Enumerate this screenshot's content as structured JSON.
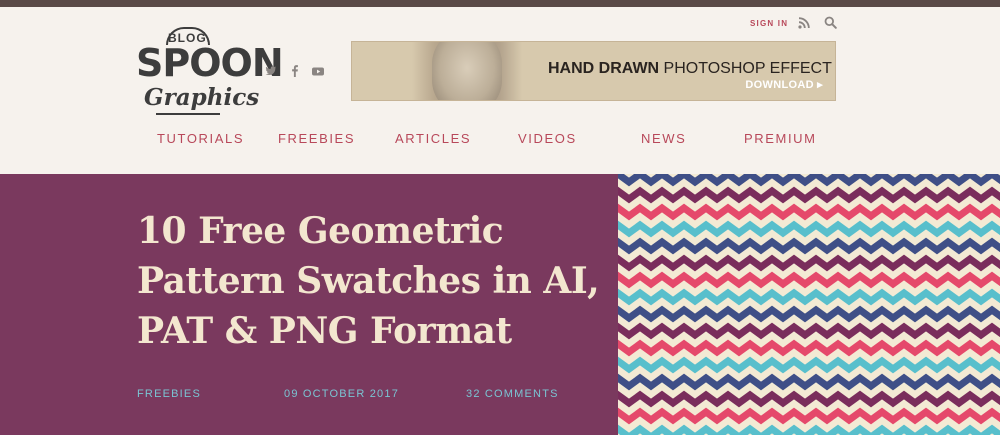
{
  "logo": {
    "blog": "BLOG.",
    "spoon": "SPOON",
    "graphics": "Graphics"
  },
  "social": [
    {
      "name": "twitter-icon",
      "glyph": "🐦"
    },
    {
      "name": "facebook-icon",
      "glyph": "f"
    },
    {
      "name": "youtube-icon",
      "glyph": "▶"
    }
  ],
  "utility": {
    "signin": "SIGN IN",
    "rss": "rss-icon",
    "search": "search-icon"
  },
  "banner": {
    "headline_bold": "HAND DRAWN",
    "headline_rest": " PHOTOSHOP EFFECT",
    "download": "DOWNLOAD ▸"
  },
  "nav": [
    "TUTORIALS",
    "FREEBIES",
    "ARTICLES",
    "VIDEOS",
    "NEWS",
    "PREMIUM"
  ],
  "hero": {
    "title": "10 Free Geometric Pattern Swatches in AI, PAT & PNG Format",
    "category": "FREEBIES",
    "date": "09 OCTOBER 2017",
    "comments": "32 COMMENTS"
  },
  "colors": {
    "accent": "#b8485a",
    "hero_bg": "#7a395e",
    "title": "#f3e7cf",
    "meta": "#7ac4d3",
    "pattern": [
      "#e5496b",
      "#58bfcc",
      "#3f4f87",
      "#7a2d5c"
    ]
  }
}
